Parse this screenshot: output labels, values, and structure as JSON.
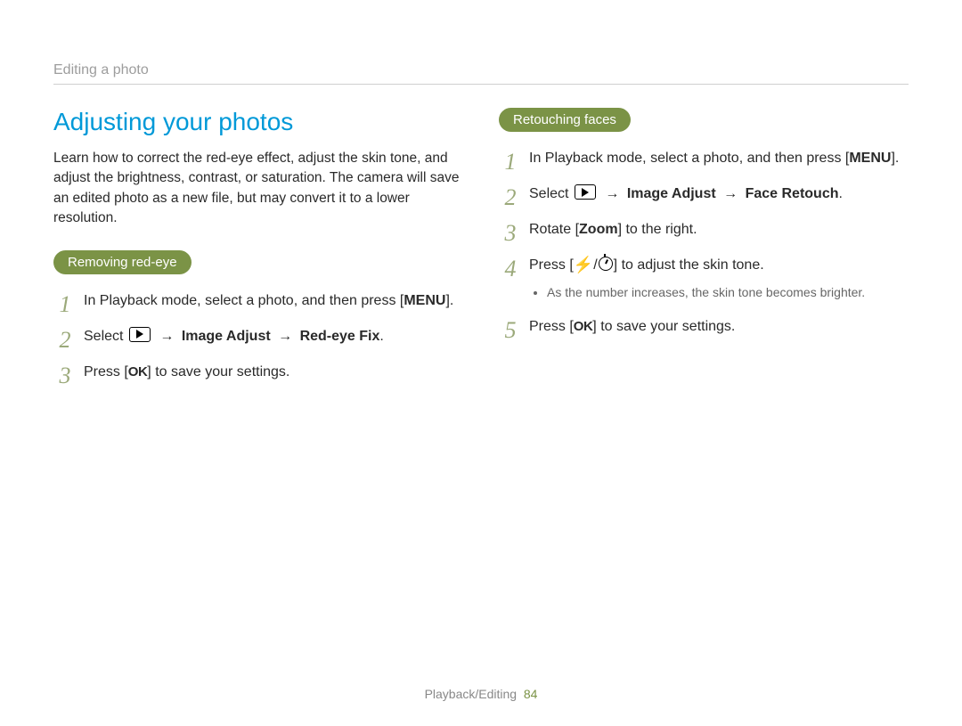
{
  "breadcrumb": "Editing a photo",
  "section_title": "Adjusting your photos",
  "intro": "Learn how to correct the red-eye effect, adjust the skin tone, and adjust the brightness, contrast, or saturation. The camera will save an edited photo as a new file, but may convert it to a lower resolution.",
  "left": {
    "pill": "Removing red-eye",
    "step1_a": "In Playback mode, select a photo, and then press [",
    "step1_menu": "MENU",
    "step1_b": "].",
    "step2_a": "Select ",
    "step2_arrow1": " → ",
    "step2_b": "Image Adjust",
    "step2_arrow2": " → ",
    "step2_c": "Red-eye Fix",
    "step2_d": ".",
    "step3_a": "Press [",
    "step3_ok": "OK",
    "step3_b": "] to save your settings."
  },
  "right": {
    "pill": "Retouching faces",
    "step1_a": "In Playback mode, select a photo, and then press [",
    "step1_menu": "MENU",
    "step1_b": "].",
    "step2_a": "Select ",
    "step2_arrow1": " → ",
    "step2_b": "Image Adjust",
    "step2_arrow2": " → ",
    "step2_c": "Face Retouch",
    "step2_d": ".",
    "step3_a": "Rotate [",
    "step3_zoom": "Zoom",
    "step3_b": "] to the right.",
    "step4_a": "Press [",
    "step4_b": "/",
    "step4_c": "] to adjust the skin tone.",
    "step4_sub": "As the number increases, the skin tone becomes brighter.",
    "step5_a": "Press [",
    "step5_ok": "OK",
    "step5_b": "] to save your settings."
  },
  "footer": {
    "section": "Playback/Editing",
    "page": "84"
  }
}
